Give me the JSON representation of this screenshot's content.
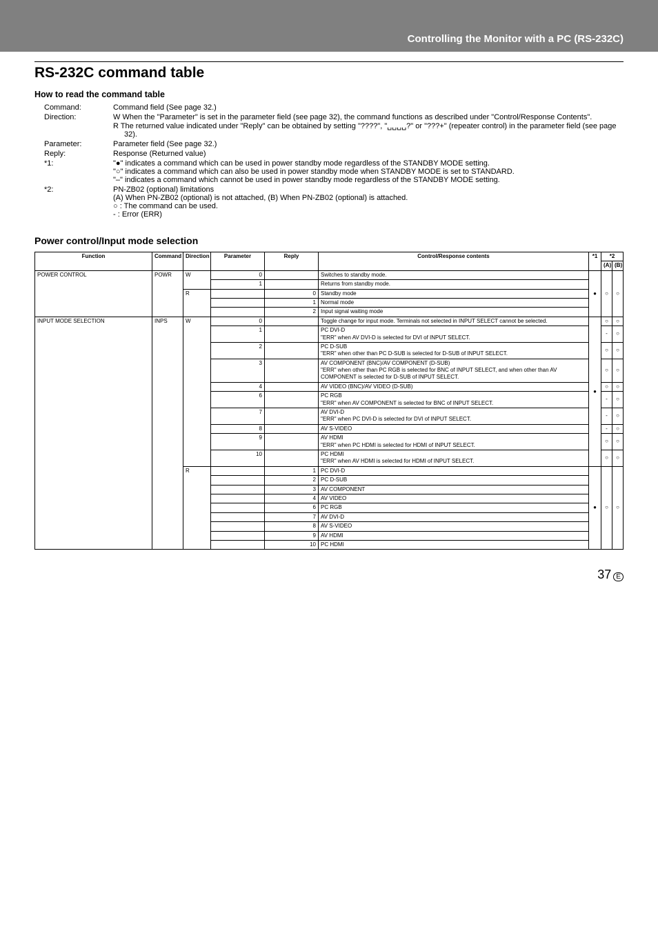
{
  "header": "Controlling the Monitor with a PC (RS-232C)",
  "h1": "RS-232C command table",
  "h2": "How to read the command table",
  "defs": {
    "cmd_l": "Command:",
    "cmd_t": "Command field (See page 32.)",
    "dir_l": "Direction:",
    "dir_w": "W  When the \"Parameter\" is set in the parameter field (see page 32), the command functions as described under \"Control/Response Contents\".",
    "dir_r": "R  The returned value indicated under \"Reply\" can be obtained by setting \"????\", \"␣␣␣␣?\" or \"???+\" (repeater control) in the parameter field (see page 32).",
    "par_l": "Parameter:",
    "par_t": "Parameter field (See page 32.)",
    "rep_l": "Reply:",
    "rep_t": "Response (Returned value)",
    "s1_l": "*1:",
    "s1_a": "\"●\" indicates a command which can be used in power standby mode regardless of the STANDBY MODE setting.",
    "s1_b": "\"○\" indicates a command which can also be used in power standby mode when STANDBY MODE is set to STANDARD.",
    "s1_c": "\"–\" indicates a command which cannot be used in power standby mode regardless of the STANDBY MODE setting.",
    "s2_l": "*2:",
    "s2_a": "PN-ZB02 (optional) limitations",
    "s2_b": "(A) When PN-ZB02 (optional) is not attached, (B) When PN-ZB02 (optional) is attached.",
    "s2_c": "○ : The command can be used.",
    "s2_d": "-  : Error (ERR)"
  },
  "h3": "Power control/Input mode selection",
  "th": {
    "fn": "Function",
    "cmd": "Command",
    "dir": "Direction",
    "par": "Parameter",
    "rep": "Reply",
    "crc": "Control/Response contents",
    "s1": "*1",
    "s2": "*2",
    "a": "(A)",
    "b": "(B)"
  },
  "t": {
    "pc_fn": "POWER CONTROL",
    "pc_cmd": "POWR",
    "w": "W",
    "r": "R",
    "pc_w0": "Switches to standby mode.",
    "pc_w1": "Returns from standby mode.",
    "pc_r0": "Standby mode",
    "pc_r1": "Normal mode",
    "pc_r2": "Input signal waiting mode",
    "ims_fn": "INPUT MODE SELECTION",
    "ims_cmd": "INPS",
    "ims0": "Toggle change for input mode. Terminals not selected in INPUT SELECT cannot be selected.",
    "ims1": "PC DVI-D\n\"ERR\" when AV DVI-D is selected for DVI of INPUT SELECT.",
    "ims2": "PC D-SUB\n\"ERR\" when other than PC D-SUB is selected for D-SUB of INPUT SELECT.",
    "ims3": "AV COMPONENT (BNC)/AV COMPONENT (D-SUB)\n\"ERR\" when other than PC RGB is selected for BNC of INPUT SELECT, and when other than AV COMPONENT is selected for D-SUB of INPUT SELECT.",
    "ims4": "AV VIDEO (BNC)/AV VIDEO (D-SUB)",
    "ims6": "PC RGB\n\"ERR\" when AV COMPONENT is selected for BNC of INPUT SELECT.",
    "ims7": "AV DVI-D\n\"ERR\" when PC DVI-D is selected for DVI of INPUT SELECT.",
    "ims8": "AV S-VIDEO",
    "ims9": "AV HDMI\n\"ERR\" when PC HDMI is selected for HDMI of INPUT SELECT.",
    "ims10": "PC HDMI\n\"ERR\" when AV HDMI is selected for HDMI of INPUT SELECT.",
    "r1": "PC DVI-D",
    "r2": "PC D-SUB",
    "r3": "AV COMPONENT",
    "r4": "AV VIDEO",
    "r6": "PC RGB",
    "r7": "AV DVI-D",
    "r8": "AV S-VIDEO",
    "r9": "AV HDMI",
    "r10": "PC HDMI",
    "dot": "●",
    "cir": "○",
    "dash": "-",
    "p0": "0",
    "p1": "1",
    "p2": "2",
    "p3": "3",
    "p4": "4",
    "p6": "6",
    "p7": "7",
    "p8": "8",
    "p9": "9",
    "p10": "10"
  },
  "page": "37",
  "pageE": "E"
}
